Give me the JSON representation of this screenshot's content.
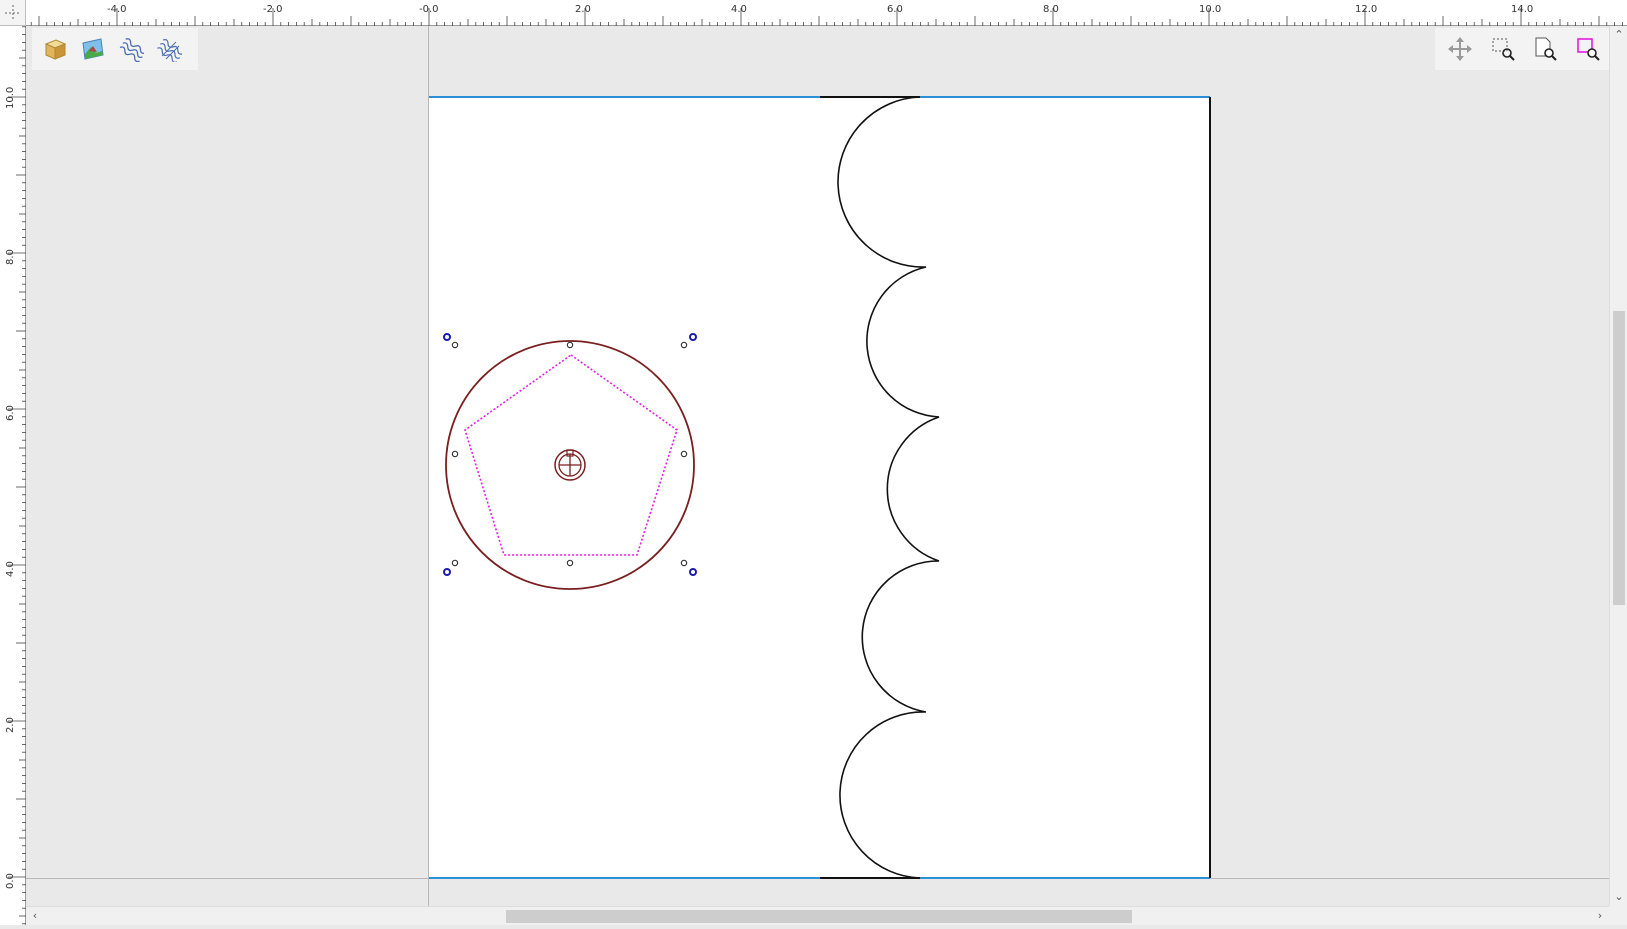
{
  "rulers": {
    "top_labels": [
      "-4.0",
      "-2.0",
      "-0.0",
      "2.0",
      "4.0",
      "6.0",
      "8.0",
      "10.0",
      "12.0",
      "14.0"
    ],
    "left_labels": [
      "10.0",
      "8.0",
      "6.0",
      "4.0",
      "2.0",
      "0.0"
    ]
  },
  "toolbar_left": {
    "items": [
      {
        "name": "3d-box-icon"
      },
      {
        "name": "image-icon"
      },
      {
        "name": "wave-pattern-icon"
      },
      {
        "name": "wave-crosshatch-icon"
      }
    ]
  },
  "toolbar_right": {
    "items": [
      {
        "name": "pan-icon"
      },
      {
        "name": "zoom-selection-icon"
      },
      {
        "name": "zoom-page-icon"
      },
      {
        "name": "zoom-objects-icon"
      }
    ]
  },
  "scrollbars": {
    "up": "⌃",
    "down": "⌄",
    "left": "‹",
    "right": "›"
  },
  "colors": {
    "circle": "#7a1f1f",
    "pentagon": "#e31ee3",
    "page_edge": "#2d8fd6",
    "handle": "#1a1ab0",
    "outline": "#111111"
  }
}
